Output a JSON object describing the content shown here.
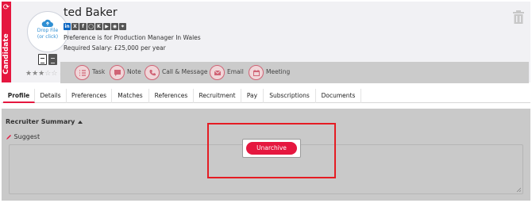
{
  "rail": {
    "label": "Candidate"
  },
  "avatar": {
    "drop_line1": "Drop File",
    "drop_line2": "(or click)"
  },
  "candidate": {
    "name": "ted Baker",
    "preference": "Preference is for Production Manager In Wales",
    "salary": "Required Salary: £25,000 per year",
    "rating": 3,
    "rating_max": 5
  },
  "socials": [
    {
      "icon": "linkedin-icon",
      "glyph": "in"
    },
    {
      "icon": "x-icon",
      "glyph": "X"
    },
    {
      "icon": "facebook-icon",
      "glyph": "f"
    },
    {
      "icon": "github-icon",
      "glyph": "◯"
    },
    {
      "icon": "xing-icon",
      "glyph": "K"
    },
    {
      "icon": "youtube-icon",
      "glyph": "▶"
    },
    {
      "icon": "portfolio-icon",
      "glyph": "◉"
    },
    {
      "icon": "location-icon",
      "glyph": "⌖"
    }
  ],
  "actions": [
    {
      "label": "Task",
      "icon": "task-list-icon"
    },
    {
      "label": "Note",
      "icon": "note-icon"
    },
    {
      "label": "Call & Message",
      "icon": "phone-icon"
    },
    {
      "label": "Email",
      "icon": "email-icon"
    },
    {
      "label": "Meeting",
      "icon": "calendar-icon"
    }
  ],
  "tabs": [
    {
      "label": "Profile",
      "active": true
    },
    {
      "label": "Details"
    },
    {
      "label": "Preferences"
    },
    {
      "label": "Matches"
    },
    {
      "label": "References"
    },
    {
      "label": "Recruitment"
    },
    {
      "label": "Pay"
    },
    {
      "label": "Subscriptions"
    },
    {
      "label": "Documents"
    }
  ],
  "recruiter_summary": {
    "title": "Recruiter Summary",
    "suggest_label": "Suggest"
  },
  "unarchive": {
    "label": "Unarchive"
  },
  "colors": {
    "accent": "#e5173f",
    "highlight": "#e51c23",
    "overlay": "#c9c9c9"
  }
}
